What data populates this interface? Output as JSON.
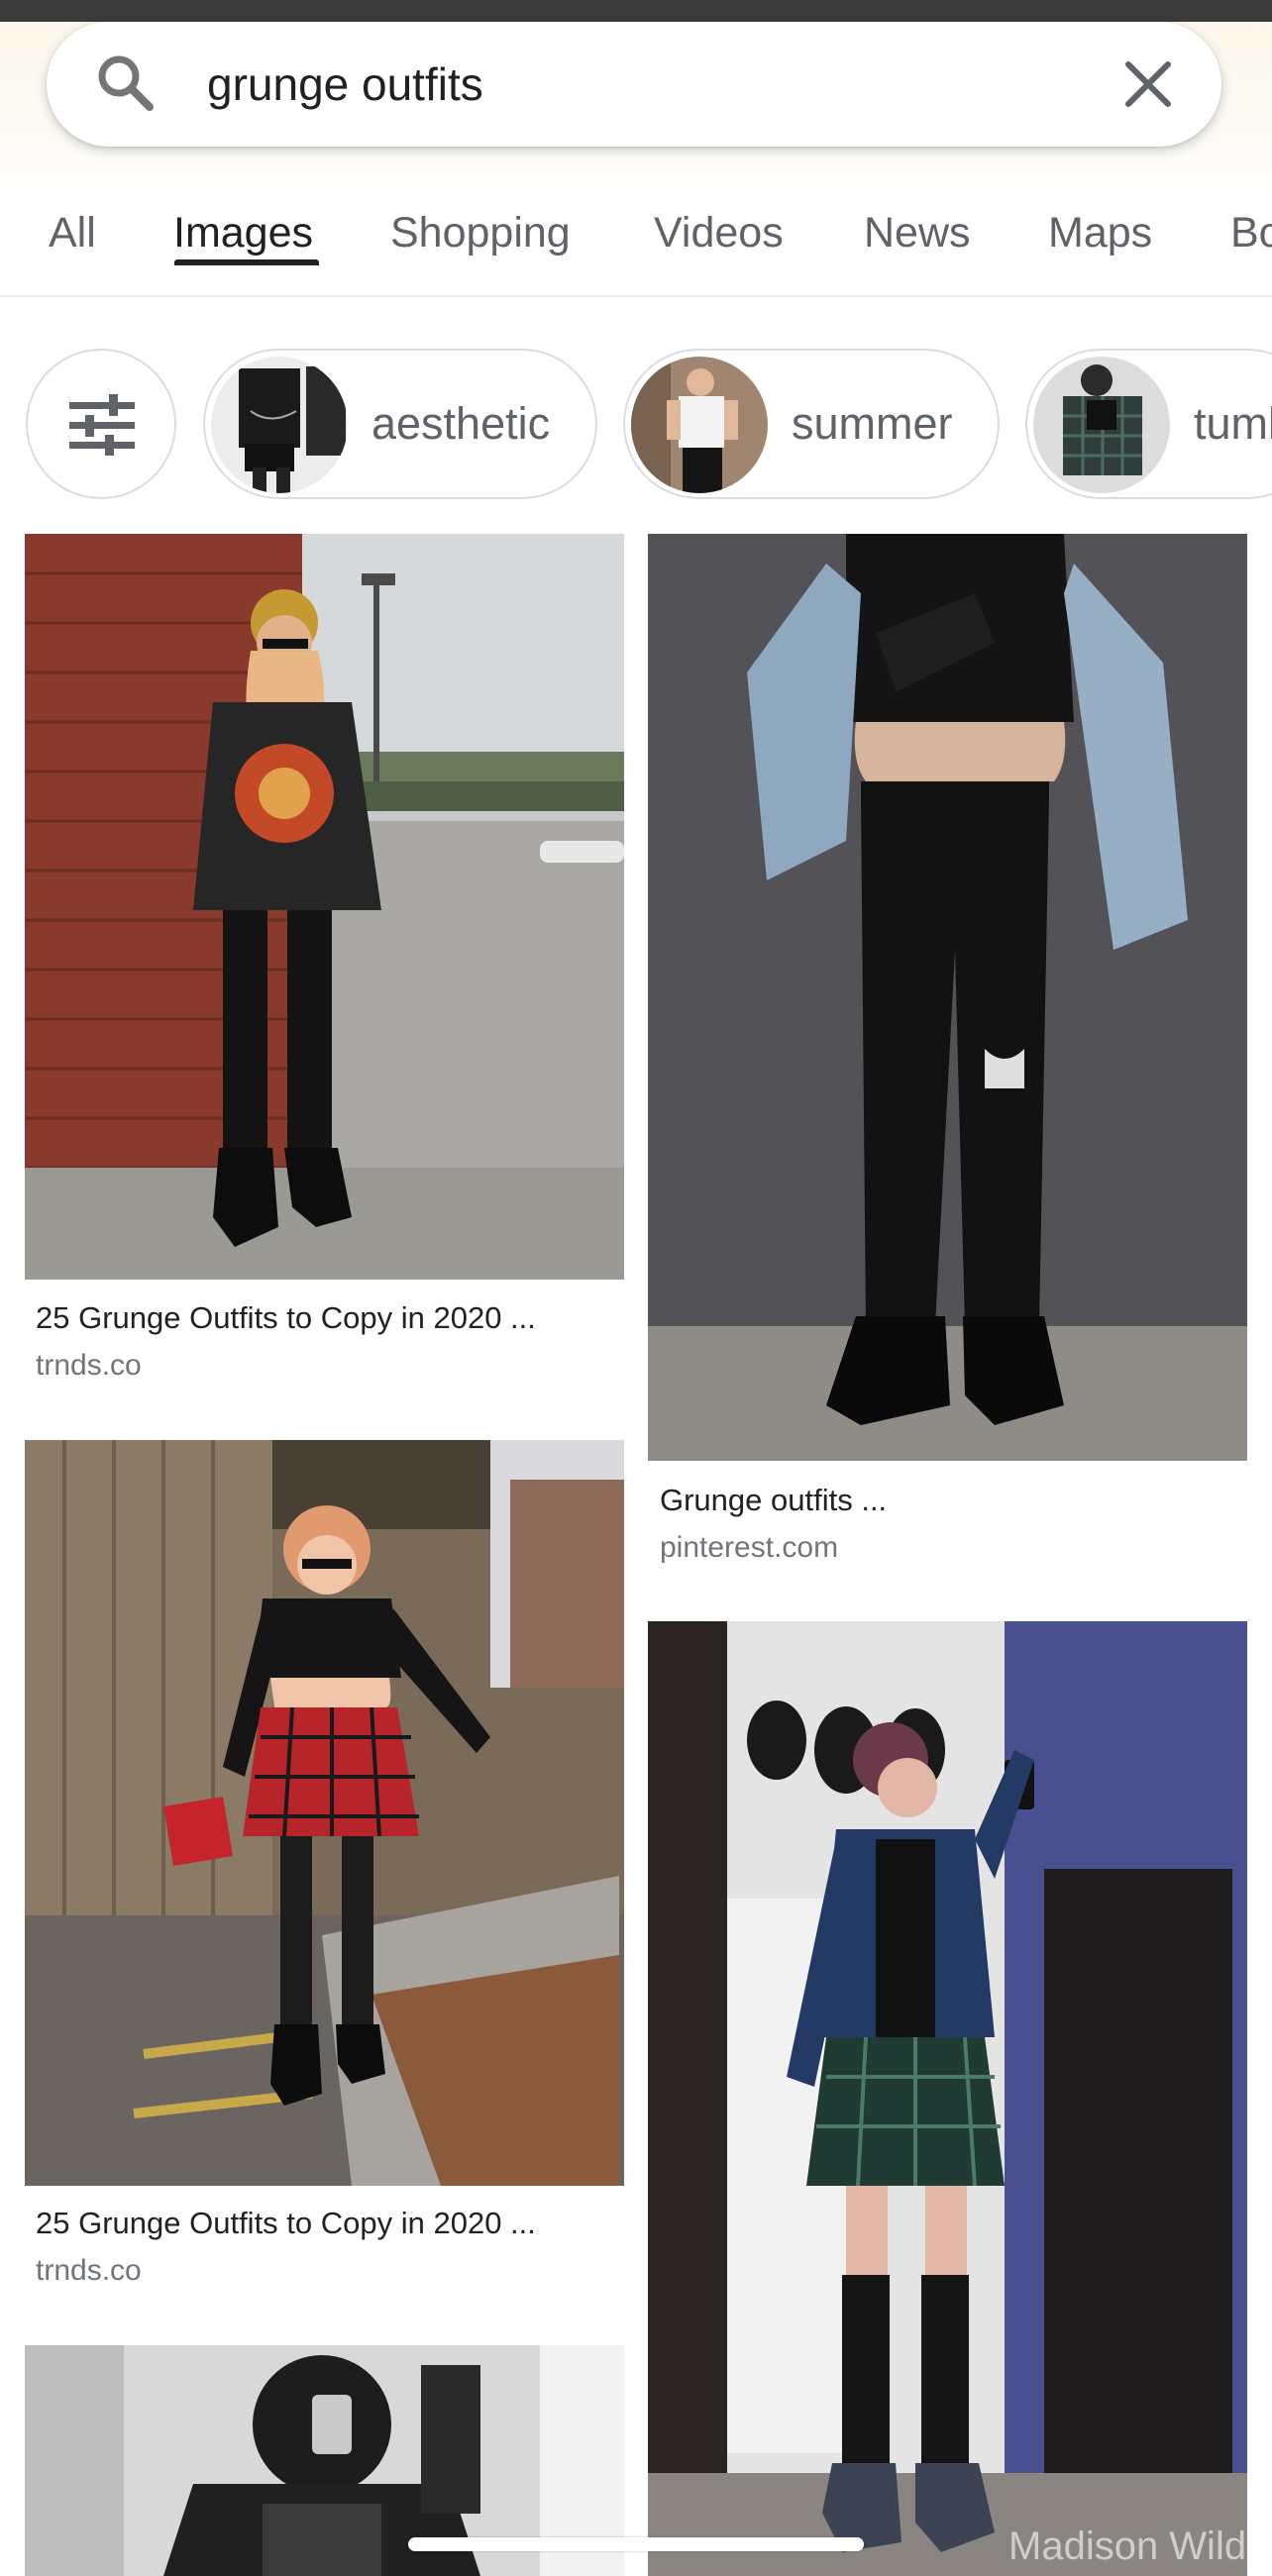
{
  "search": {
    "query": "grunge outfits",
    "search_icon": "search-icon",
    "clear_icon": "close-icon"
  },
  "tabs": [
    {
      "label": "All",
      "active": false
    },
    {
      "label": "Images",
      "active": true
    },
    {
      "label": "Shopping",
      "active": false
    },
    {
      "label": "Videos",
      "active": false
    },
    {
      "label": "News",
      "active": false
    },
    {
      "label": "Maps",
      "active": false
    },
    {
      "label": "Bo",
      "active": false
    }
  ],
  "chips": {
    "filter_icon": "tune-icon",
    "items": [
      {
        "label": "aesthetic"
      },
      {
        "label": "summer"
      },
      {
        "label": "tuml"
      }
    ]
  },
  "results": [
    {
      "title": "25 Grunge Outfits to Copy in 2020 ...",
      "domain": "trnds.co"
    },
    {
      "title": "Grunge outfits ...",
      "domain": "pinterest.com"
    },
    {
      "title": "25 Grunge Outfits to Copy in 2020 ...",
      "domain": "trnds.co"
    }
  ],
  "watermark": "Madison Wilde",
  "colors": {
    "active_tab": "#202124",
    "inactive_tab": "#5f6368",
    "domain_text": "#70757a"
  }
}
